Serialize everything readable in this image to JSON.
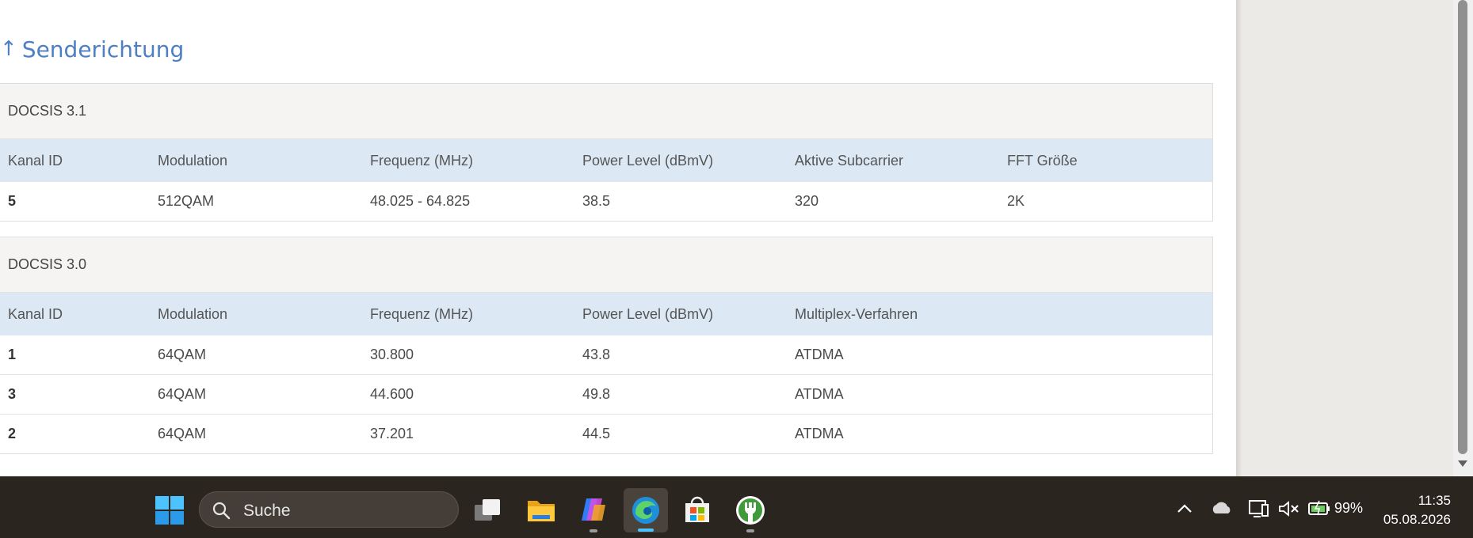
{
  "section": {
    "arrow": "↑",
    "title": "Senderichtung"
  },
  "docsis31": {
    "caption": "DOCSIS 3.1",
    "headers": [
      "Kanal ID",
      "Modulation",
      "Frequenz (MHz)",
      "Power Level (dBmV)",
      "Aktive Subcarrier",
      "FFT Größe"
    ],
    "rows": [
      [
        "5",
        "512QAM",
        "48.025 - 64.825",
        "38.5",
        "320",
        "2K"
      ]
    ]
  },
  "docsis30": {
    "caption": "DOCSIS 3.0",
    "headers": [
      "Kanal ID",
      "Modulation",
      "Frequenz (MHz)",
      "Power Level (dBmV)",
      "Multiplex-Verfahren"
    ],
    "rows": [
      [
        "1",
        "64QAM",
        "30.800",
        "43.8",
        "ATDMA"
      ],
      [
        "3",
        "64QAM",
        "44.600",
        "49.8",
        "ATDMA"
      ],
      [
        "2",
        "64QAM",
        "37.201",
        "44.5",
        "ATDMA"
      ]
    ]
  },
  "taskbar": {
    "search_label": "Suche",
    "battery_percent": "99%",
    "time": "11:35",
    "date": "05.08.2026",
    "icons": [
      "windows-start-icon",
      "search-icon",
      "task-view-icon",
      "file-explorer-icon",
      "copilot-icon",
      "edge-icon",
      "store-icon",
      "app-icon",
      "chevron-up-icon",
      "cloud-icon",
      "network-icon",
      "volume-muted-icon",
      "battery-icon"
    ]
  },
  "colors": {
    "accent": "#4e7fc4",
    "table_header": "#dce8f4",
    "caption_bg": "#f5f4f2",
    "taskbar": "#2b2520"
  }
}
